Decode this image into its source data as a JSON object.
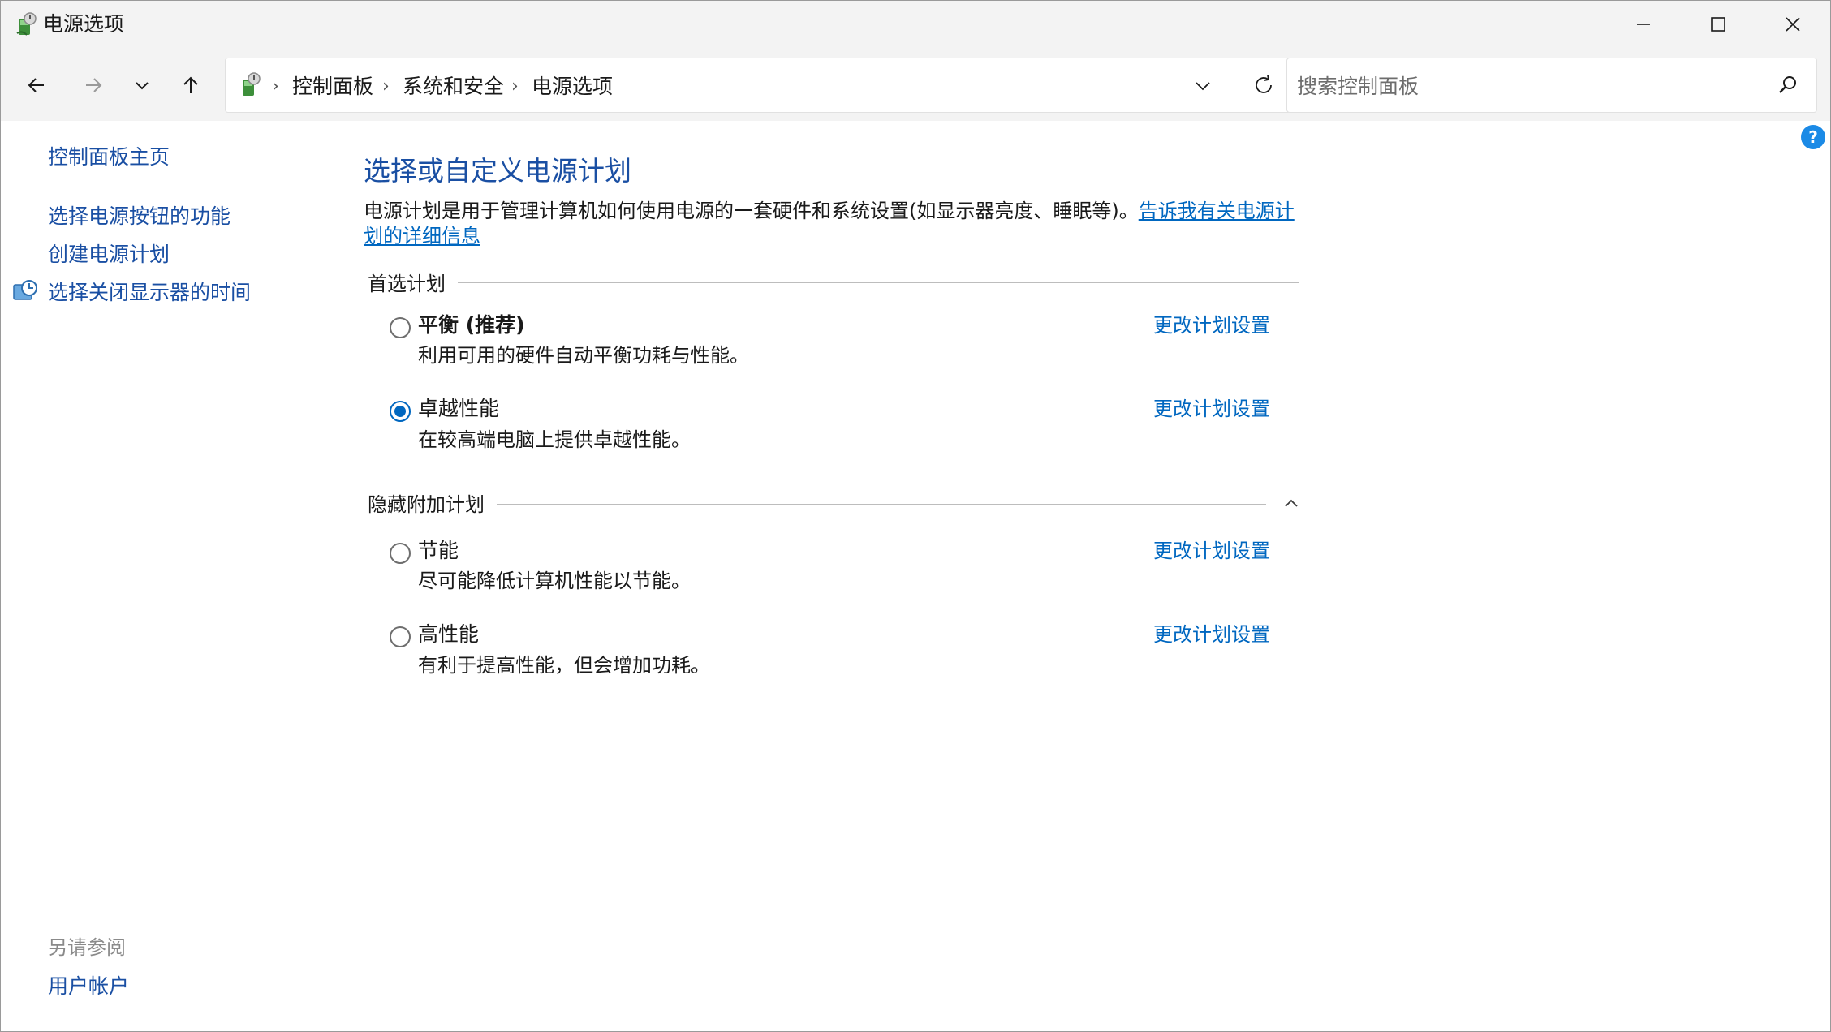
{
  "window": {
    "title": "电源选项"
  },
  "address": {
    "crumbs": [
      "控制面板",
      "系统和安全",
      "电源选项"
    ],
    "search_placeholder": "搜索控制面板"
  },
  "left_pane": {
    "home_link": "控制面板主页",
    "links": [
      "选择电源按钮的功能",
      "创建电源计划",
      "选择关闭显示器的时间"
    ],
    "see_also_heading": "另请参阅",
    "see_also_links": [
      "用户帐户"
    ]
  },
  "main": {
    "title": "选择或自定义电源计划",
    "description": "电源计划是用于管理计算机如何使用电源的一套硬件和系统设置(如显示器亮度、睡眠等)。",
    "description_link": "告诉我有关电源计划的详细信息",
    "preferred_group": "首选计划",
    "hidden_group": "隐藏附加计划",
    "change_label": "更改计划设置",
    "preferred_plans": [
      {
        "name": "平衡 (推荐)",
        "desc": "利用可用的硬件自动平衡功耗与性能。",
        "selected": false
      },
      {
        "name": "卓越性能",
        "desc": "在较高端电脑上提供卓越性能。",
        "selected": true
      }
    ],
    "hidden_plans": [
      {
        "name": "节能",
        "desc": "尽可能降低计算机性能以节能。",
        "selected": false
      },
      {
        "name": "高性能",
        "desc": "有利于提高性能，但会增加功耗。",
        "selected": false
      }
    ]
  },
  "colors": {
    "link_blue": "#0067c0",
    "nav_link_blue": "#1a4fa3",
    "chrome_bg": "#f3f3f3"
  }
}
